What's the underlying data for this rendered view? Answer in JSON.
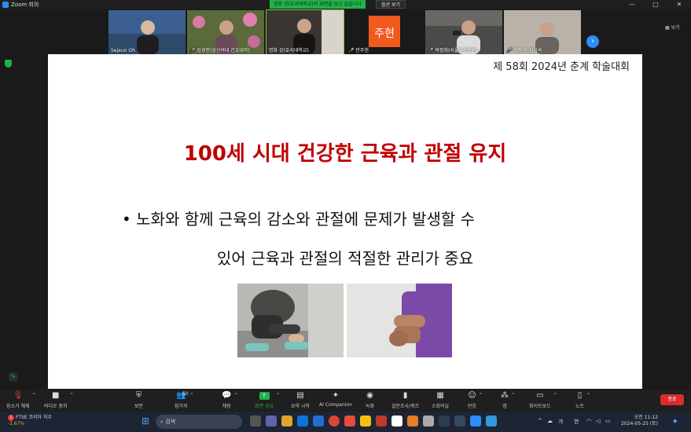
{
  "window": {
    "title": "Zoom 회의",
    "controls": [
      "—",
      "□",
      "✕"
    ]
  },
  "share_banner": {
    "text": "명화 강(호서대학교)의 화면을 보고 있습니다",
    "view_options": "옵션 보기"
  },
  "participants": [
    {
      "name": "Sejeun Oh",
      "muted": false,
      "bg": "#2f4a6a"
    },
    {
      "name": "임경춘(성신여대 간호대학)",
      "muted": true,
      "bg": "#5a6a3a"
    },
    {
      "name": "명화 강(호서대학교)",
      "muted": false,
      "bg": "#3a3530",
      "active": true
    },
    {
      "name": "안주현",
      "muted": true,
      "bg": "#1a1a1a",
      "initials": "주현",
      "initials_color": "#f05a1e"
    },
    {
      "name": "박정희(서울아산병원)",
      "muted": true,
      "bg": "#4a4a48"
    },
    {
      "name": "대동대_김삼숙",
      "muted": true,
      "bg": "#5a5550"
    }
  ],
  "gallery": {
    "view_label": "보기",
    "next_icon": "chevron-right-icon"
  },
  "slide": {
    "conference": "제 58회 2024년 춘계 학술대회",
    "title": "100세 시대 건강한 근육과 관절 유지",
    "bullet_line1": "• 노화와 함께 근육의 감소와 관절에 문제가 발생할 수",
    "bullet_line2": "있어 근육과 관절의 적절한 관리가 중요"
  },
  "toolbar": {
    "unmute": "음소거 해제",
    "stop_video": "비디오 중지",
    "security": "보안",
    "participants": "참가자",
    "participants_count": "50",
    "chat": "채팅",
    "share": "화면 공유",
    "summary": "요약 시작",
    "ai": "AI Companion",
    "record": "녹화",
    "polls": "설문조사/퀴즈",
    "breakout": "소회의실",
    "reactions": "반응",
    "apps": "앱",
    "whiteboard": "화이트보드",
    "notes": "노트",
    "end": "종료"
  },
  "taskbar": {
    "stock_name": "FTSE 코리아 지수",
    "stock_change": "-1.67%",
    "notification_count": "1",
    "search_placeholder": "검색",
    "ime1": "가",
    "ime2": "한",
    "time": "오전 11:12",
    "date": "2024-05-25 (토)"
  },
  "colors": {
    "accent": "#2d8cff",
    "share_green": "#22b14c",
    "end_red": "#d92c2c",
    "slide_title": "#c00000"
  }
}
